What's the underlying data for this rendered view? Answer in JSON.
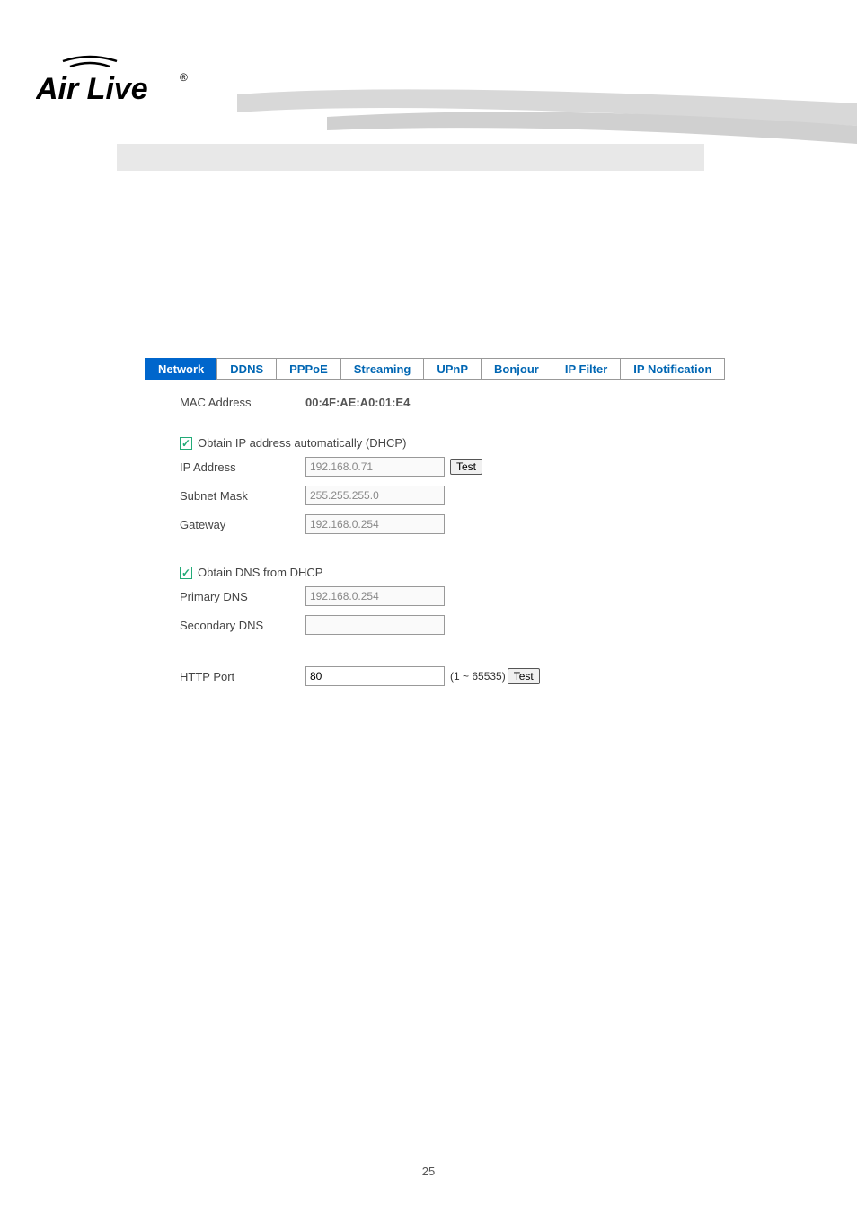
{
  "logo": {
    "brand": "Air Live",
    "registered": "®"
  },
  "tabs": [
    {
      "label": "Network",
      "active": true
    },
    {
      "label": "DDNS",
      "active": false
    },
    {
      "label": "PPPoE",
      "active": false
    },
    {
      "label": "Streaming",
      "active": false
    },
    {
      "label": "UPnP",
      "active": false
    },
    {
      "label": "Bonjour",
      "active": false
    },
    {
      "label": "IP Filter",
      "active": false
    },
    {
      "label": "IP Notification",
      "active": false
    }
  ],
  "form": {
    "mac_label": "MAC Address",
    "mac_value": "00:4F:AE:A0:01:E4",
    "dhcp_checkbox": "Obtain IP address automatically (DHCP)",
    "ip_label": "IP Address",
    "ip_value": "192.168.0.71",
    "test_btn": "Test",
    "subnet_label": "Subnet Mask",
    "subnet_value": "255.255.255.0",
    "gateway_label": "Gateway",
    "gateway_value": "192.168.0.254",
    "dns_checkbox": "Obtain DNS from DHCP",
    "primary_dns_label": "Primary DNS",
    "primary_dns_value": "192.168.0.254",
    "secondary_dns_label": "Secondary DNS",
    "secondary_dns_value": "",
    "http_port_label": "HTTP Port",
    "http_port_value": "80",
    "port_range": "(1 ~ 65535)"
  },
  "page_number": "25"
}
